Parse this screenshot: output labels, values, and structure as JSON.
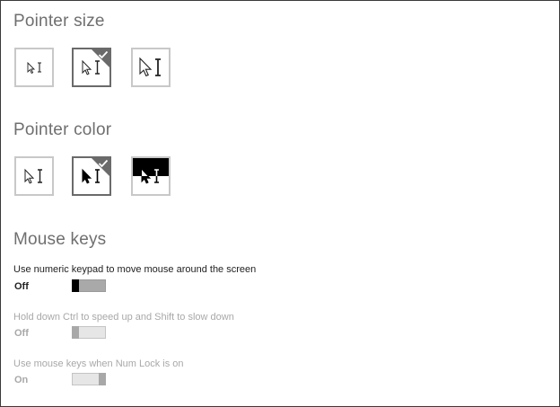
{
  "pointer_size": {
    "title": "Pointer size",
    "options": [
      {
        "size": "small",
        "selected": false
      },
      {
        "size": "medium",
        "selected": true
      },
      {
        "size": "large",
        "selected": false
      }
    ]
  },
  "pointer_color": {
    "title": "Pointer color",
    "options": [
      {
        "color": "white",
        "selected": false
      },
      {
        "color": "black",
        "selected": true
      },
      {
        "color": "inverted",
        "selected": false
      }
    ]
  },
  "mouse_keys": {
    "title": "Mouse keys",
    "settings": [
      {
        "label": "Use numeric keypad to move mouse around the screen",
        "state": "Off",
        "enabled": true
      },
      {
        "label": "Hold down Ctrl to speed up and Shift to slow down",
        "state": "Off",
        "enabled": false
      },
      {
        "label": "Use mouse keys when Num Lock is on",
        "state": "On",
        "enabled": false
      }
    ]
  },
  "colors": {
    "selected_border": "#6a6a6a",
    "unselected_border": "#c8c8c8",
    "title_gray": "#6f6f6f",
    "disabled_text": "#a8a8a8"
  },
  "icons": [
    "arrow-pointer-icon",
    "text-cursor-icon",
    "checkmark-icon"
  ]
}
